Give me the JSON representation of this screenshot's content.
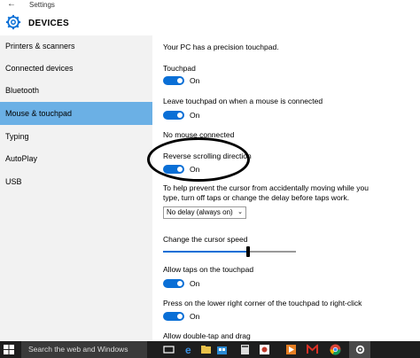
{
  "window": {
    "title": "Settings",
    "back_glyph": "←"
  },
  "header": {
    "title": "DEVICES",
    "icon": "gear-icon"
  },
  "sidebar": {
    "items": [
      {
        "label": "Printers & scanners"
      },
      {
        "label": "Connected devices"
      },
      {
        "label": "Bluetooth"
      },
      {
        "label": "Mouse & touchpad",
        "selected": true
      },
      {
        "label": "Typing"
      },
      {
        "label": "AutoPlay"
      },
      {
        "label": "USB"
      }
    ]
  },
  "main": {
    "intro": "Your PC has a precision touchpad.",
    "touchpad": {
      "label": "Touchpad",
      "state": "On"
    },
    "leave_touchpad": {
      "label": "Leave touchpad on when a mouse is connected",
      "state": "On"
    },
    "no_mouse": "No mouse connected",
    "reverse_scroll": {
      "label": "Reverse scrolling direction",
      "state": "On"
    },
    "delay_help_line1": "To help prevent the cursor from accidentally moving while you",
    "delay_help_line2": "type, turn off taps or change the delay before taps work.",
    "delay_select": {
      "value": "No delay (always on)"
    },
    "cursor_speed": {
      "label": "Change the cursor speed",
      "level_fraction": 0.64
    },
    "allow_taps": {
      "label": "Allow taps on the touchpad",
      "state": "On"
    },
    "right_click": {
      "label": "Press on the lower right corner of the touchpad to right-click",
      "state": "On"
    },
    "double_tap": {
      "label": "Allow double-tap and drag"
    }
  },
  "taskbar": {
    "search_placeholder": "Search the web and Windows",
    "icons": [
      "task-view-icon",
      "edge-icon",
      "file-explorer-icon",
      "store-icon",
      "calculator-icon",
      "camera-app-icon",
      "media-player-icon",
      "gmail-icon",
      "chrome-icon",
      "settings-icon"
    ]
  },
  "colors": {
    "accent": "#0a6fd6",
    "sidebar_selected": "#6bb0e5",
    "sidebar_bg": "#f2f2f2",
    "taskbar": "#1e1e1e"
  }
}
